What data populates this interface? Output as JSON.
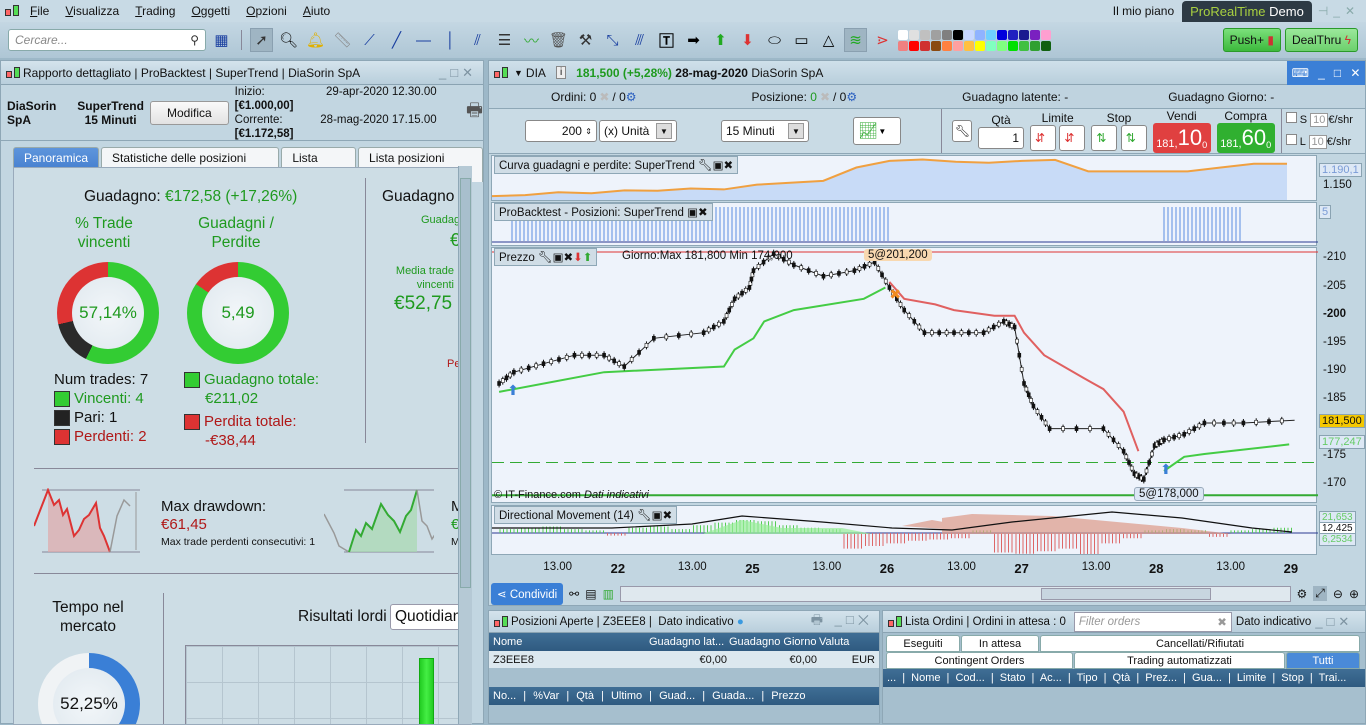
{
  "menu": [
    "File",
    "Visualizza",
    "Trading",
    "Oggetti",
    "Opzioni",
    "Aiuto"
  ],
  "top_right": {
    "plan": "Il mio piano",
    "brand": "ProRealTime",
    "brand_mode": "Demo",
    "push": "Push+",
    "dealthru": "DealThru"
  },
  "toolbar": {
    "search_placeholder": "Cercare...",
    "colors": [
      "#ffffff",
      "#e0e0e0",
      "#c0c0c0",
      "#a0a0a0",
      "#808080",
      "#000000",
      "#c8d8ff",
      "#8fb3ff",
      "#6fd0ff",
      "#0000dd",
      "#2020c0",
      "#1a1a90",
      "#7a20c0",
      "#ff9fd0",
      "#f08080",
      "#ff0000",
      "#d03030",
      "#8a4a10",
      "#ff8040",
      "#ffa0a0",
      "#ffc040",
      "#ffff00",
      "#80ffc0",
      "#80ff80",
      "#00e000",
      "#40c040",
      "#30a030",
      "#106010"
    ]
  },
  "report": {
    "title_parts": [
      "Rapporto dettagliato",
      "ProBacktest",
      "SuperTrend",
      "DiaSorin SpA"
    ],
    "instrument": "DiaSorin SpA",
    "system": "SuperTrend",
    "timeframe": "15 Minuti",
    "modify": "Modifica",
    "start_label": "Inizio:",
    "start_date": "29-apr-2020 12.30.00",
    "start_value": "[€1.000,00]",
    "current_label": "Corrente:",
    "current_date": "28-mag-2020 17.15.00",
    "current_value": "[€1.172,58]",
    "tabs": [
      "Panoramica",
      "Statistiche delle posizioni chiuse",
      "Lista ordini",
      "Lista posizioni chiuse"
    ],
    "gain_label": "Guadagno:",
    "gain_value": "€172,58 (+17,26%)",
    "winpct_title": "% Trade vincenti",
    "winpct_value": "57,14%",
    "winpct": 57.14,
    "draw_pct": 14.29,
    "gl_title": "Guadagni / Perdite",
    "gl_value": "5,49",
    "gain_total_num": 211.02,
    "loss_total_num": 38.44,
    "num_trades": "Num trades: 7",
    "winners": "Vincenti: 4",
    "draws": "Pari: 1",
    "losers": "Perdenti: 2",
    "gain_total_label": "Guadagno totale:",
    "gain_total": "€211,02",
    "loss_total_label": "Perdita totale:",
    "loss_total": "-€38,44",
    "right_col_title": "Guadagno",
    "right_col_sub": "Guadag",
    "right_col_cur": "€",
    "avg_win_label": "Media trade vincenti",
    "avg_win": "€52,75",
    "per_cut": "Pe",
    "max_dd_label": "Max drawdown:",
    "max_dd": "€61,45",
    "max_loss_consec": "Max trade perdenti consecutivi:  1",
    "runup_cut": "M",
    "runup_val_cut": "€",
    "runup_sub_cut": "M",
    "time_in_market_title": "Tempo nel mercato",
    "time_in_market": "52,25%",
    "time_in_market_pct": 52.25,
    "gross_results_label": "Risultati lordi",
    "gross_period": "Quotidian"
  },
  "chart": {
    "symbol": "DIA",
    "price": "181,500 (+5,28%)",
    "date": "28-mag-2020",
    "name": "DiaSorin SpA",
    "orders": "Ordini: 0",
    "orders2": "/ 0",
    "position": "Posizione:",
    "position_val": "0",
    "position2": "/ 0",
    "latent": "Guadagno latente: -",
    "day_gain": "Guadagno Giorno: -",
    "qty_value": "200",
    "unit": "(x) Unità",
    "timeframe": "15 Minuti",
    "qty_label": "Qtà",
    "qty": "1",
    "limit": "Limite",
    "stop": "Stop",
    "sell": "Vendi",
    "buy": "Compra",
    "sell_int": "181,",
    "sell_dec": "10",
    "sell_sup": "0",
    "buy_int": "181,",
    "buy_dec": "60",
    "buy_sup": "0",
    "s": "S",
    "l": "L",
    "tick": "10",
    "per_shr": "€/shr",
    "equity_label": "Curva guadagni e perdite: SuperTrend",
    "equity_last": "1.190,1",
    "equity_tick": "1.150",
    "positions_label": "ProBacktest - Posizioni: SuperTrend",
    "positions_last": "5",
    "price_label": "Prezzo",
    "day_range": "Giorno:Max 181,800 Min 174,000",
    "order_top": "5@201,200",
    "order_bottom": "5@178,000",
    "copyright": "© IT-Finance.com",
    "indicative": "Dati indicativi",
    "price_last": "181,500",
    "supertrend_last": "177,247",
    "dm_label": "Directional Movement (14)",
    "dm_vals": [
      "21,653",
      "12,425",
      "6,2534"
    ],
    "share": "Condividi"
  },
  "chart_data": {
    "type": "line",
    "ylim": [
      167,
      212
    ],
    "yticks": [
      "210",
      "205",
      "200",
      "195",
      "190",
      "185",
      "175",
      "170"
    ],
    "ytick_vals": [
      210,
      205,
      200,
      195,
      190,
      185,
      175,
      170
    ],
    "xticks": [
      "13.00",
      "22",
      "13.00",
      "25",
      "13.00",
      "26",
      "13.00",
      "27",
      "13.00",
      "28",
      "13.00",
      "29"
    ],
    "price": [
      [
        0.06,
        188
      ],
      [
        0.17,
        190
      ],
      [
        0.39,
        191.5
      ],
      [
        0.62,
        193
      ],
      [
        0.84,
        193
      ],
      [
        0.99,
        191
      ],
      [
        1.21,
        196
      ],
      [
        1.58,
        197
      ],
      [
        1.73,
        199
      ],
      [
        1.81,
        203
      ],
      [
        1.92,
        205
      ],
      [
        1.95,
        208
      ],
      [
        2.1,
        211
      ],
      [
        2.25,
        209
      ],
      [
        2.47,
        207
      ],
      [
        2.7,
        208
      ],
      [
        2.85,
        209.5
      ],
      [
        2.96,
        205
      ],
      [
        3.07,
        201
      ],
      [
        3.22,
        197
      ],
      [
        3.44,
        197
      ],
      [
        3.66,
        197
      ],
      [
        3.81,
        199
      ],
      [
        3.89,
        198
      ],
      [
        3.96,
        188
      ],
      [
        4.03,
        184
      ],
      [
        4.15,
        180
      ],
      [
        4.55,
        180
      ],
      [
        4.7,
        176
      ],
      [
        4.78,
        172
      ],
      [
        4.85,
        171
      ],
      [
        4.93,
        177
      ],
      [
        5.0,
        178
      ],
      [
        5.15,
        179
      ],
      [
        5.3,
        181
      ],
      [
        5.59,
        181
      ],
      [
        5.97,
        181.5
      ]
    ],
    "supertrend_up": [
      [
        0.06,
        186.5
      ],
      [
        0.84,
        190
      ],
      [
        1.73,
        191
      ],
      [
        1.81,
        194
      ],
      [
        1.95,
        196
      ],
      [
        2.03,
        199
      ],
      [
        2.25,
        201
      ],
      [
        2.77,
        203
      ],
      [
        2.93,
        205
      ]
    ],
    "supertrend_down": [
      [
        2.96,
        206
      ],
      [
        3.07,
        203
      ],
      [
        3.3,
        202
      ],
      [
        3.44,
        201
      ],
      [
        3.74,
        200
      ],
      [
        3.89,
        200
      ],
      [
        3.96,
        197
      ],
      [
        4.11,
        193
      ],
      [
        4.4,
        189
      ],
      [
        4.55,
        187
      ],
      [
        4.7,
        183
      ],
      [
        4.81,
        176
      ]
    ],
    "supertrend_up2": [
      [
        5.0,
        172.5
      ],
      [
        5.15,
        175
      ],
      [
        5.3,
        175.5
      ],
      [
        5.93,
        177.2
      ]
    ],
    "horizontal_levels": [
      211.3,
      174,
      168.2
    ],
    "equity": [
      1000,
      1005,
      1020,
      1015,
      1030,
      1028,
      1040,
      1035,
      1060,
      1070,
      1080,
      1150,
      1185,
      1192,
      1180,
      1175,
      1185,
      1190,
      1130,
      1130,
      1130,
      1130,
      1150,
      1170,
      1170
    ],
    "dm_hist": [
      3,
      4,
      5,
      3,
      2,
      -2,
      4,
      5,
      3,
      6,
      8,
      10,
      9,
      6,
      4,
      3,
      -12,
      -10,
      -8,
      -6,
      -5,
      -4,
      2,
      -15,
      -16,
      -14,
      -12,
      -18,
      -8,
      -4,
      2,
      3,
      2,
      -3,
      2,
      3,
      4
    ]
  }
}
